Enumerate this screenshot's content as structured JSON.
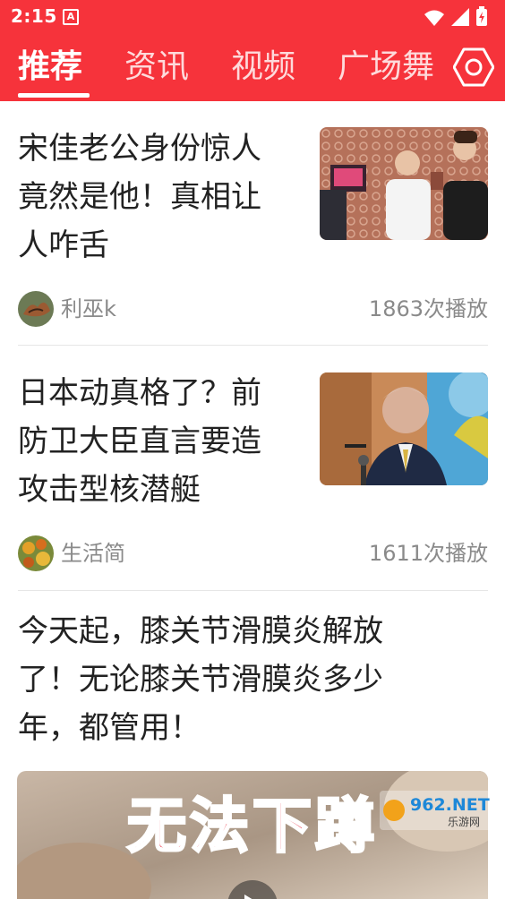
{
  "status_bar": {
    "time": "2:15",
    "notification_glyph": "A",
    "icons": [
      "wifi-icon",
      "signal-icon",
      "battery-icon"
    ]
  },
  "tabs": [
    {
      "label": "推荐",
      "active": true
    },
    {
      "label": "资讯",
      "active": false
    },
    {
      "label": "视频",
      "active": false
    },
    {
      "label": "广场舞",
      "active": false
    }
  ],
  "header_icon": "settings-hexagon-icon",
  "feed": [
    {
      "title_lines": [
        "宋佳老公身份惊人",
        "竟然是他！真相让",
        "人咋舌"
      ],
      "author": "利巫k",
      "plays": "1863次播放"
    },
    {
      "title_lines": [
        "日本动真格了？前",
        "防卫大臣直言要造",
        "攻击型核潜艇"
      ],
      "author": "生活简",
      "plays": "1611次播放"
    },
    {
      "title_lines": [
        "今天起，膝关节滑膜炎解放",
        "了！无论膝关节滑膜炎多少",
        "年，都管用！"
      ],
      "thumbnail_caption": "无法下蹲"
    }
  ],
  "watermark": {
    "brand": "962.NET",
    "subtitle": "乐游网"
  },
  "colors": {
    "header_red": "#f6333b",
    "meta_gray": "#8a8a8a",
    "title_text": "#222222"
  }
}
